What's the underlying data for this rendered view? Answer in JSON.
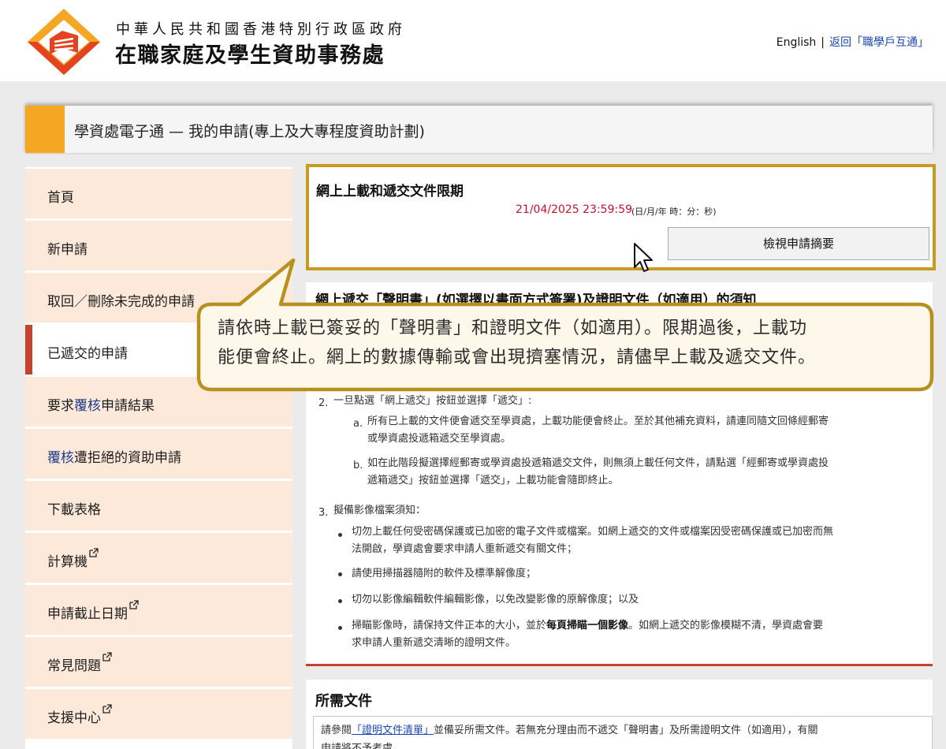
{
  "header": {
    "org_subtitle": "中華人民共和國香港特別行政區政府",
    "org_title": "在職家庭及學生資助事務處",
    "lang_link": "English",
    "separator": "|",
    "back_link": "返回「職學戶互通」"
  },
  "page_title": "學資處電子通 — 我的申請(專上及大專程度資助計劃)",
  "sidebar": {
    "items": [
      {
        "label": "首頁"
      },
      {
        "label": "新申請"
      },
      {
        "label": "取回／刪除未完成的申請"
      },
      {
        "label": "已遞交的申請"
      },
      {
        "label_pre": "要求",
        "label_blue": "覆核",
        "label_post": "申請結果"
      },
      {
        "label_blue": "覆核",
        "label_post": "遭拒絕的資助申請"
      },
      {
        "label": "下載表格"
      },
      {
        "label": "計算機"
      },
      {
        "label": "申請截止日期"
      },
      {
        "label": "常見問題"
      },
      {
        "label": "支援中心"
      }
    ]
  },
  "deadline": {
    "title": "網上上載和遞交文件限期",
    "date": "21/04/2025 23:59:59",
    "format": "(日/月/年 時：分：秒)",
    "button": "檢視申請摘要"
  },
  "notes": {
    "title": "網上遞交「聲明書」(如選擇以書面方式簽署)及證明文件（如適用）的須知",
    "item2_num": "2.",
    "item2": "一旦點選「網上遞交」按鈕並選擇「遞交」:",
    "item2a_num": "a.",
    "item2a_l1": "所有已上載的文件便會遞交至學資處，上載功能便會終止。至於其他補充資料，請連同隨文回條經郵寄",
    "item2a_l2": "或學資處投遞箱遞交至學資處。",
    "item2b_num": "b.",
    "item2b_l1": "如在此階段擬選擇經郵寄或學資處投遞箱遞交文件，則無須上載任何文件，請點選「經郵寄或學資處投",
    "item2b_l2": "遞箱遞交」按鈕並選擇「遞交」，上載功能會隨即終止。",
    "item3_num": "3.",
    "item3": "擬備影像檔案須知：",
    "bullet1_l1": "切勿上載任何受密碼保護或已加密的電子文件或檔案。如網上遞交的文件或檔案因受密碼保護或已加密而無",
    "bullet1_l2": "法開啟，學資處會要求申請人重新遞交有關文件；",
    "bullet2": "請使用掃描器隨附的軟件及標準解像度；",
    "bullet3": "切勿以影像編輯軟件編輯影像，以免改變影像的原解像度；以及",
    "bullet4_pre": "掃瞄影像時，請保持文件正本的大小，並於",
    "bullet4_bold": "每頁掃瞄一個影像",
    "bullet4_post": "。如網上遞交的影像模糊不清，學資處會要",
    "bullet4_l2": "求申請人重新遞交清晰的證明文件。"
  },
  "docs": {
    "title": "所需文件",
    "text_pre": "請參閱",
    "link": "「證明文件清單」",
    "text_post": "並備妥所需文件。若無充分理由而不遞交「聲明書」及所需證明文件（如適用），有關",
    "text_l2": "申請將不予考慮。"
  },
  "callout": {
    "line1": "請依時上載已簽妥的「聲明書」和證明文件（如適用）。限期過後，上載功",
    "line2": "能便會終止。網上的數據傳輸或會出現擠塞情況，請儘早上載及遞交文件。"
  }
}
